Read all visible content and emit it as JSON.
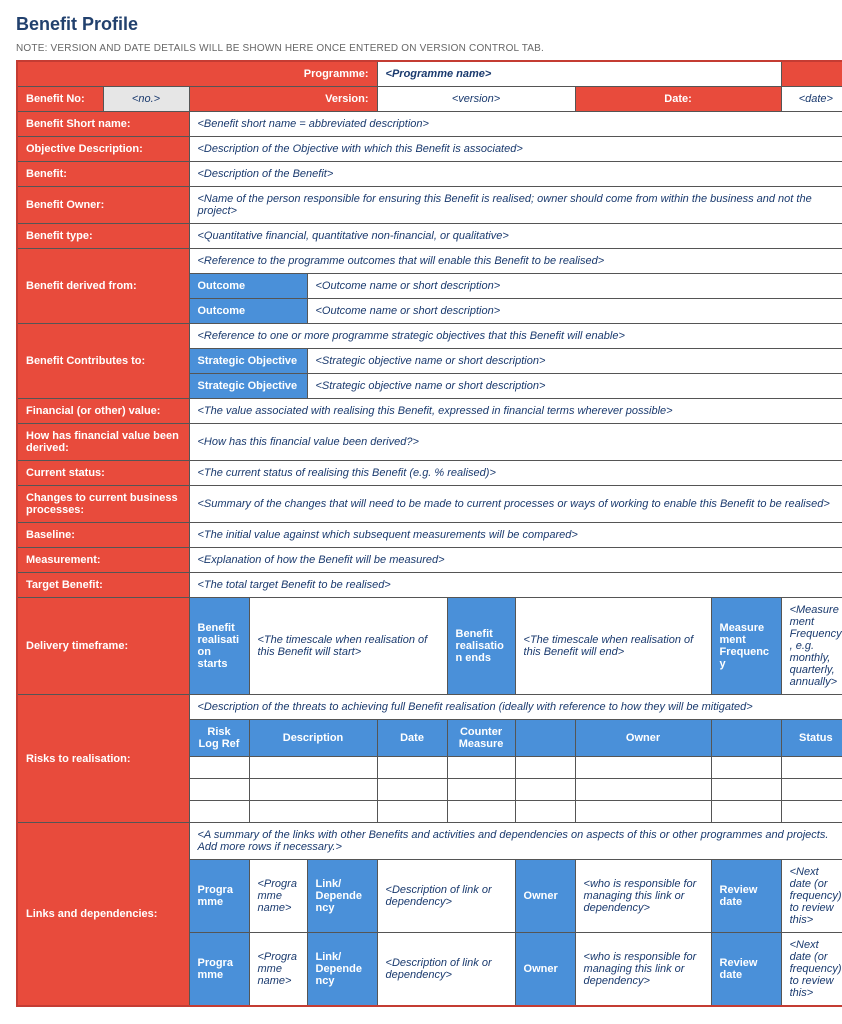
{
  "title": "Benefit Profile",
  "note": "NOTE: VERSION AND DATE DETAILS WILL BE SHOWN HERE ONCE ENTERED ON VERSION CONTROL TAB.",
  "header": {
    "programme_label": "Programme:",
    "programme_value": "<Programme name>",
    "benefit_no_label": "Benefit No:",
    "benefit_no_value": "<no.>",
    "version_label": "Version:",
    "version_value": "<version>",
    "date_label": "Date:",
    "date_value": "<date>"
  },
  "rows": {
    "short_name": {
      "label": "Benefit Short name:",
      "value": "<Benefit short name = abbreviated description>"
    },
    "objective": {
      "label": "Objective Description:",
      "value": "<Description of the Objective with which this Benefit is associated>"
    },
    "benefit": {
      "label": "Benefit:",
      "value": "<Description of the Benefit>"
    },
    "owner": {
      "label": "Benefit Owner:",
      "value": "<Name of the person responsible for ensuring this Benefit is realised; owner should come from within the business and not the project>"
    },
    "type": {
      "label": "Benefit type:",
      "value": "<Quantitative financial, quantitative non-financial, or qualitative>"
    },
    "derived": {
      "label": "Benefit derived from:",
      "desc": "<Reference to the programme outcomes that will enable this Benefit to be realised>",
      "outcome_label": "Outcome",
      "outcome1": "<Outcome name or short description>",
      "outcome2": "<Outcome name or short description>"
    },
    "contributes": {
      "label": "Benefit Contributes to:",
      "desc": "<Reference to one or more programme strategic objectives that this Benefit will enable>",
      "so_label": "Strategic Objective",
      "so1": "<Strategic objective name or short description>",
      "so2": "<Strategic objective name or short description>"
    },
    "financial_value": {
      "label": "Financial (or other) value:",
      "value": "<The value associated with realising this Benefit, expressed in financial terms wherever possible>"
    },
    "financial_derived": {
      "label": "How has financial value been derived:",
      "value": "<How has this financial value been derived?>"
    },
    "status": {
      "label": "Current status:",
      "value": "<The current status of realising this Benefit (e.g. % realised)>"
    },
    "changes": {
      "label": "Changes to current business processes:",
      "value": "<Summary of the changes that will need to be made to current processes or ways of working to enable this Benefit to be realised>"
    },
    "baseline": {
      "label": "Baseline:",
      "value": "<The initial value against which subsequent measurements will be compared>"
    },
    "measurement": {
      "label": "Measurement:",
      "value": "<Explanation of how the Benefit will be measured>"
    },
    "target": {
      "label": "Target Benefit:",
      "value": "<The total target Benefit to be realised>"
    },
    "delivery": {
      "label": "Delivery timeframe:",
      "start_label": "Benefit realisation starts",
      "start_value": "<The timescale when realisation of this Benefit will start>",
      "end_label": "Benefit realisation ends",
      "end_value": "<The timescale when realisation of this Benefit will end>",
      "freq_label": "Measurement Frequency",
      "freq_value": "<Measurement Frequency, e.g. monthly, quarterly, annually>"
    },
    "risks": {
      "label": "Risks to realisation:",
      "desc": "<Description of the threats to achieving full Benefit realisation (ideally with reference to how they will be mitigated>",
      "cols": {
        "ref": "Risk Log Ref",
        "description": "Description",
        "date": "Date",
        "counter": "Counter Measure",
        "owner": "Owner",
        "status": "Status"
      }
    },
    "links": {
      "label": "Links and dependencies:",
      "desc": "<A summary of the links with other Benefits and activities and dependencies on aspects of this or other programmes and projects.  Add more rows if necessary.>",
      "cols": {
        "programme": "Programme",
        "programme_val": "<Programme name>",
        "link": "Link/ Dependency",
        "link_val": "<Description of link or dependency>",
        "owner": "Owner",
        "owner_val": "<who is responsible for managing this link or dependency>",
        "review": "Review date",
        "review_val": "<Next date (or frequency) to review this>"
      }
    }
  }
}
